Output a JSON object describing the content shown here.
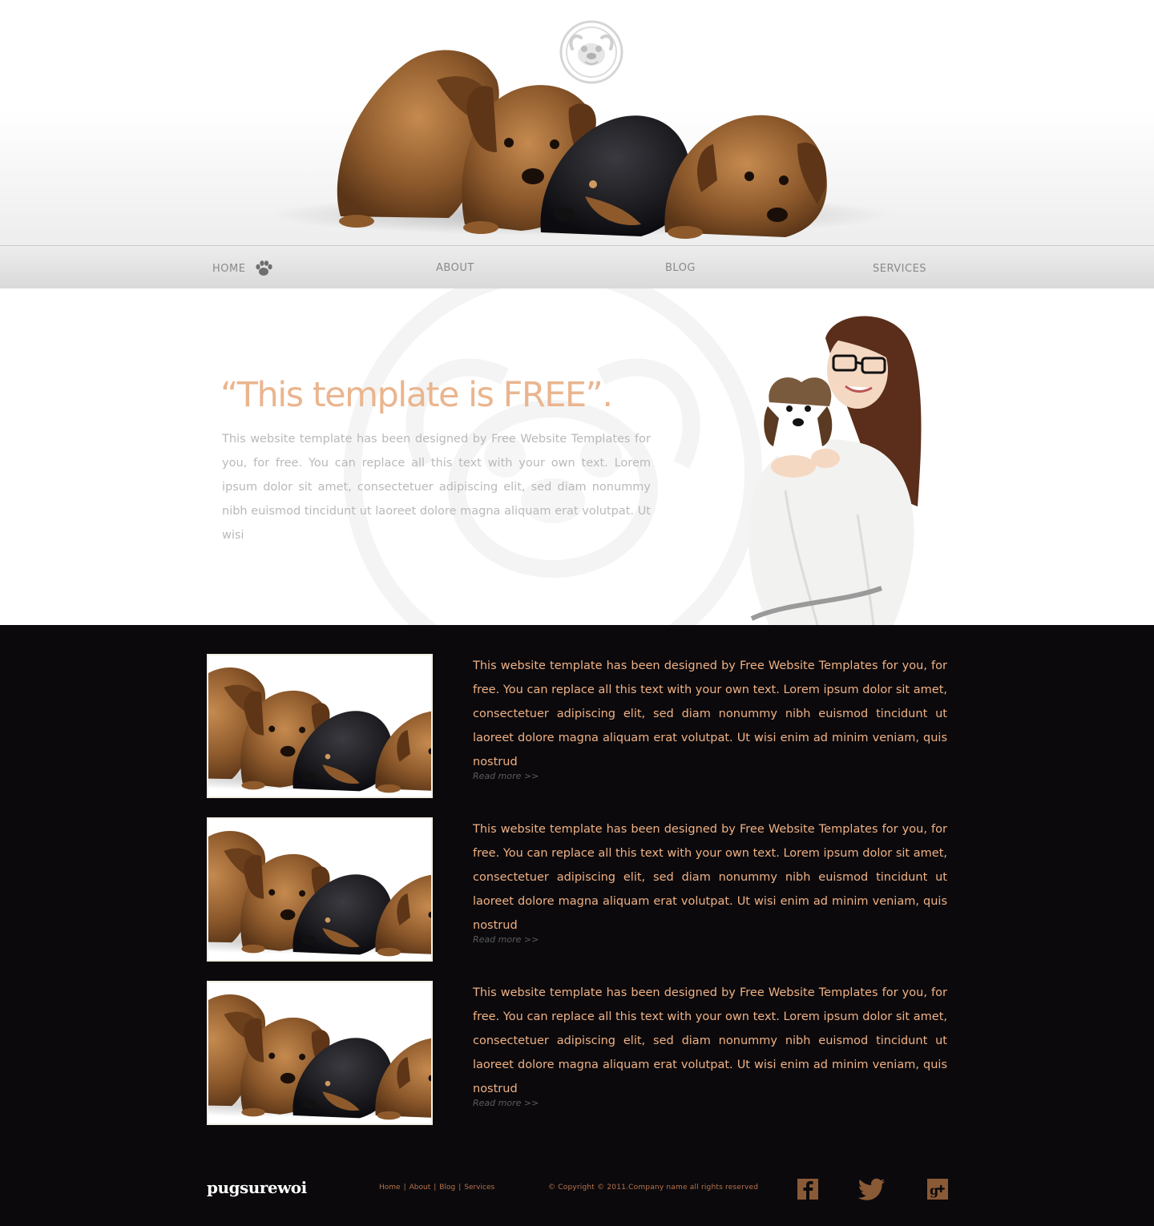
{
  "nav": {
    "items": [
      {
        "label": "HOME"
      },
      {
        "label": "ABOUT"
      },
      {
        "label": "BLOG"
      },
      {
        "label": "SERVICES"
      }
    ]
  },
  "intro": {
    "title": "“This template is FREE”.",
    "body": "This website template has been designed by Free Website Templates for you, for free. You can replace all this text with your own text. Lorem ipsum dolor sit amet, consectetuer adipiscing elit, sed diam nonummy nibh euismod tincidunt ut laoreet dolore magna aliquam erat volutpat. Ut wisi"
  },
  "posts": [
    {
      "text": "This website template has been designed by Free Website Templates for you, for free. You can replace all this text with your own text. Lorem ipsum dolor sit amet, consectetuer adipiscing elit, sed diam nonummy nibh euismod tincidunt ut laoreet dolore magna aliquam erat volutpat. Ut wisi enim ad minim veniam, quis nostrud",
      "read_more": "Read more >>"
    },
    {
      "text": "This website template has been designed by Free Website Templates for you, for free. You can replace all this text with your own text. Lorem ipsum dolor sit amet, consectetuer adipiscing elit, sed diam nonummy nibh euismod tincidunt ut laoreet dolore magna aliquam erat volutpat. Ut wisi enim ad minim veniam, quis nostrud",
      "read_more": "Read more >>"
    },
    {
      "text": "This website template has been designed by Free Website Templates for you, for free. You can replace all this text with your own text. Lorem ipsum dolor sit amet, consectetuer adipiscing elit, sed diam nonummy nibh euismod tincidunt ut laoreet dolore magna aliquam erat volutpat. Ut wisi enim ad minim veniam, quis nostrud",
      "read_more": "Read more >>"
    }
  ],
  "footer": {
    "brand": "pugsurewoi",
    "links": [
      {
        "label": "Home"
      },
      {
        "label": "About"
      },
      {
        "label": "Blog"
      },
      {
        "label": "Services"
      }
    ],
    "copyright": "© Copyright © 2011.Company name all rights reserved",
    "social": [
      {
        "icon": "facebook-icon"
      },
      {
        "icon": "twitter-icon"
      },
      {
        "icon": "google-plus-icon"
      }
    ]
  },
  "colors": {
    "accent_peach": "#eab58e",
    "footer_text": "#b8744b",
    "dark_bg": "#0b090c"
  }
}
